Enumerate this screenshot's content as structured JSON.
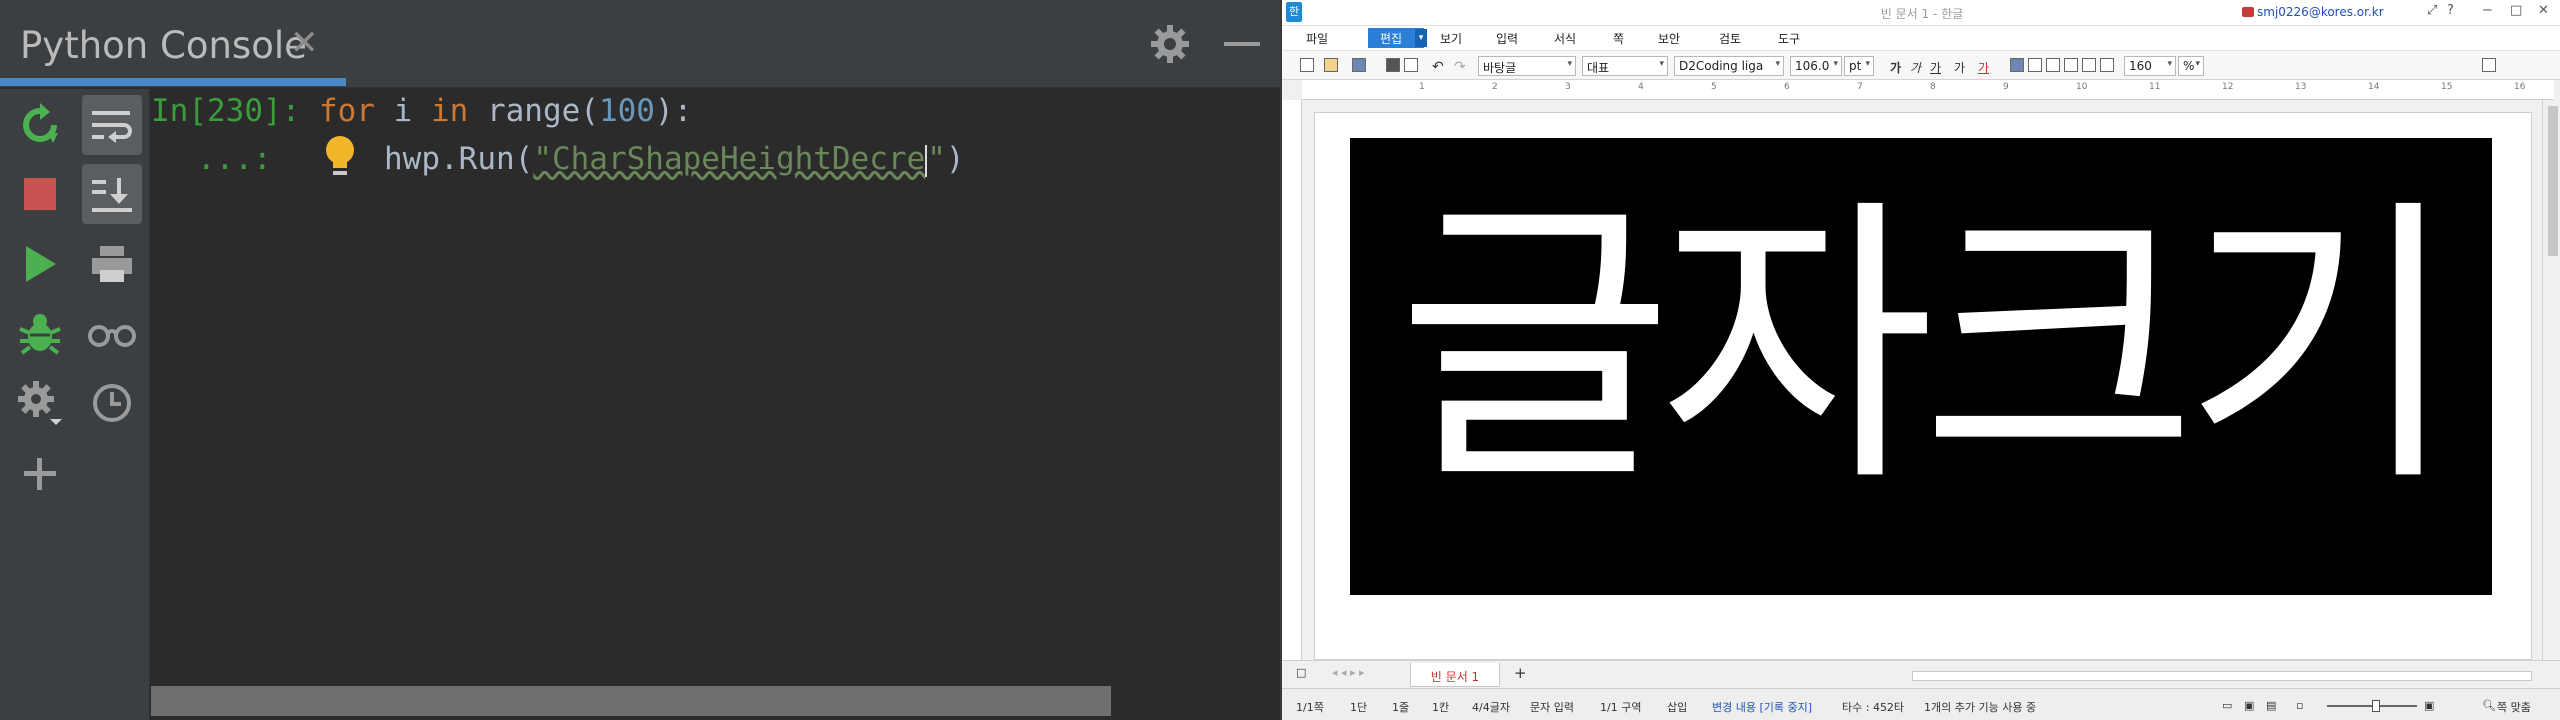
{
  "console": {
    "tab_title": "Python Console",
    "close_glyph": "✕",
    "prompt_in": "In[230]:",
    "line1_for": "for",
    "line1_mid1": " i ",
    "line1_in": "in",
    "line1_mid2": " range(",
    "line1_num": "100",
    "line1_end": "):",
    "prompt_cont": "...:",
    "line2_code": "hwp.Run(",
    "line2_string": "\"CharShapeHeightDecre",
    "line2_string_end": "\"",
    "line2_close": ")",
    "colors": {
      "accent_tab": "#4a88c7",
      "prompt": "#3b9c3b",
      "keyword": "#cc7832",
      "number": "#6897bb",
      "string": "#6a8759",
      "text": "#a9b7c6"
    },
    "toolbar1_icons": [
      "rerun-icon",
      "stop-icon",
      "run-icon",
      "debug-icon",
      "settings-icon",
      "add-icon"
    ],
    "toolbar2_icons": [
      "soft-wrap-icon",
      "scroll-to-end-icon",
      "print-icon",
      "show-variables-icon",
      "history-icon"
    ]
  },
  "hwp": {
    "window_title": "빈 문서 1 - 한글",
    "account": "smj0226@kores.or.kr",
    "menus": [
      "파일",
      "편집",
      "보기",
      "입력",
      "서식",
      "쪽",
      "보안",
      "검토",
      "도구"
    ],
    "toolbar": {
      "style": "바탕글",
      "rep": "대표",
      "font": "D2Coding liga",
      "size": "106.0",
      "unit": "pt",
      "bold": "가",
      "italic": "가",
      "underline": "가",
      "strike": "가",
      "color": "가",
      "line_spacing": "160",
      "line_spacing_unit": "%"
    },
    "ruler_ticks": [
      "1",
      "2",
      "3",
      "4",
      "5",
      "6",
      "7",
      "8",
      "9",
      "10",
      "11",
      "12",
      "13",
      "14",
      "15",
      "16"
    ],
    "doc_text": "글자크기",
    "doc_tab": "빈 문서 1",
    "status": {
      "page": "1/1쪽",
      "section": "1단",
      "line": "1줄",
      "col": "1칸",
      "chars": "4/4글자",
      "mode": "문자 입력",
      "area": "1/1 구역",
      "insert": "삽입",
      "track": "변경 내용 [기록 중지]",
      "typing": "타수 : 452타",
      "extra": "1개의 추가 기능 사용 중",
      "fit": "쪽 맞춤"
    }
  }
}
